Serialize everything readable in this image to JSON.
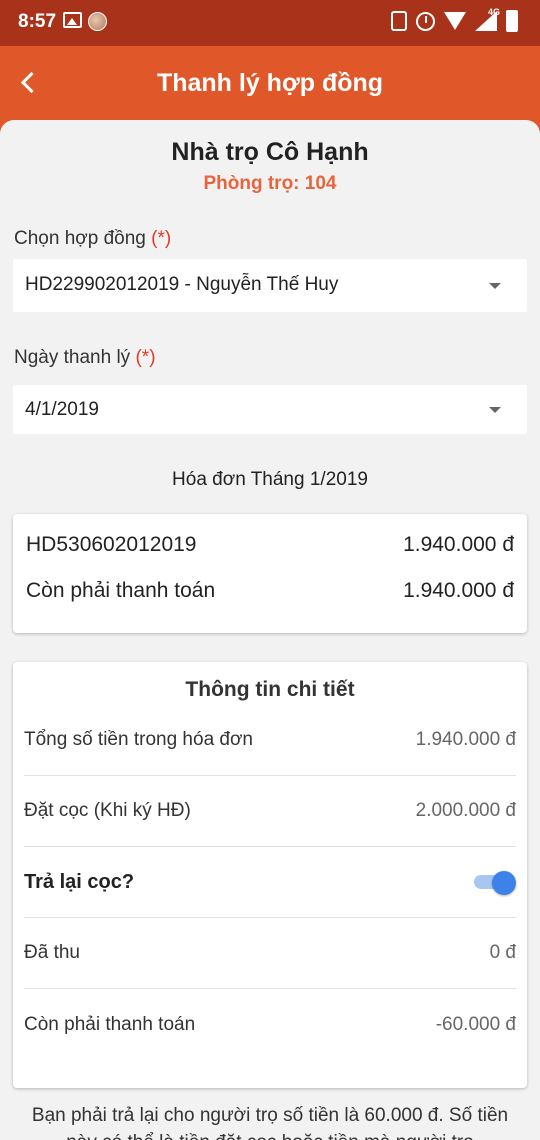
{
  "status_bar": {
    "time": "8:57",
    "network": "4G"
  },
  "header": {
    "title": "Thanh lý hợp đồng"
  },
  "property": {
    "name": "Nhà trọ Cô  Hạnh",
    "room": "Phòng trọ: 104"
  },
  "contract": {
    "label": "Chọn hợp đồng",
    "required": "(*)",
    "value": "HD229902012019 - Nguyễn Thế Huy"
  },
  "liquidation_date": {
    "label": "Ngày thanh lý",
    "required": "(*)",
    "value": "4/1/2019"
  },
  "invoice": {
    "heading": "Hóa đơn Tháng 1/2019",
    "code": "HD530602012019",
    "code_amount": "1.940.000 đ",
    "remaining_label": "Còn phải thanh toán",
    "remaining_amount": "1.940.000 đ"
  },
  "details": {
    "title": "Thông tin chi tiết",
    "rows": [
      {
        "label": "Tổng số tiền trong hóa đơn",
        "value": "1.940.000 đ"
      },
      {
        "label": "Đặt cọc (Khi ký HĐ)",
        "value": "2.000.000 đ"
      },
      {
        "label": "Trả lại cọc?",
        "toggle_on": true
      },
      {
        "label": "Đã thu",
        "value": "0 đ"
      },
      {
        "label": "Còn phải thanh toán",
        "value": "-60.000 đ"
      }
    ]
  },
  "footer_note": "Bạn phải trả lại cho người trọ số tiền là 60.000 đ. Số tiền này có thể là tiền đặt cọc hoặc tiền mà người trọ",
  "colors": {
    "accent": "#e0582a",
    "status_bar": "#a8331a",
    "room_text": "#e8643a",
    "required": "#e03b2b",
    "toggle": "#3d82e8"
  }
}
